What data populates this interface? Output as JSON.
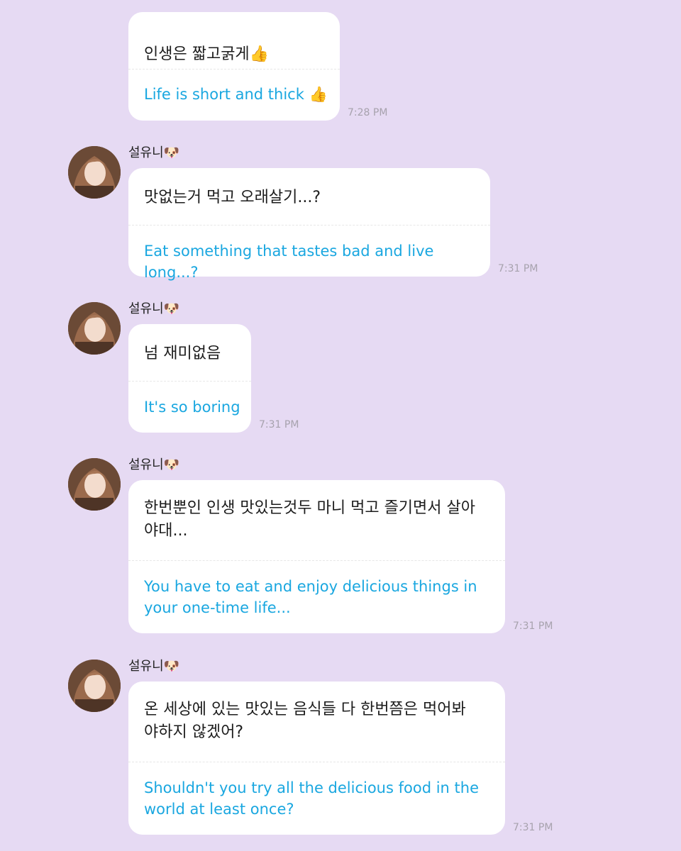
{
  "colors": {
    "background": "#e6daf3",
    "bubble": "#ffffff",
    "korean_text": "#1c1c1c",
    "translation_text": "#1aa7e0",
    "timestamp": "#a7a2ad"
  },
  "messages": [
    {
      "sender": "",
      "show_avatar": false,
      "korean": "인생은 짧고굵게👍",
      "english": "Life is short and thick 👍",
      "time": "7:28 PM"
    },
    {
      "sender": "설유니🐶",
      "show_avatar": true,
      "korean": "맛없는거 먹고 오래살기...?",
      "english": "Eat something that tastes bad and live long...?",
      "time": "7:31 PM"
    },
    {
      "sender": "설유니🐶",
      "show_avatar": true,
      "korean": "넘 재미없음",
      "english": "It's so boring",
      "time": "7:31 PM"
    },
    {
      "sender": "설유니🐶",
      "show_avatar": true,
      "korean": "한번뿐인 인생 맛있는것두 마니 먹고 즐기면서 살아\n야대...",
      "english": "You have to eat and enjoy delicious things in\nyour one-time life...",
      "time": "7:31 PM"
    },
    {
      "sender": "설유니🐶",
      "show_avatar": true,
      "korean": "온 세상에 있는 맛있는 음식들 다 한번쯤은 먹어봐\n야하지 않겠어?",
      "english": "Shouldn't you try all the delicious food in the\nworld at least once?",
      "time": "7:31 PM"
    }
  ]
}
